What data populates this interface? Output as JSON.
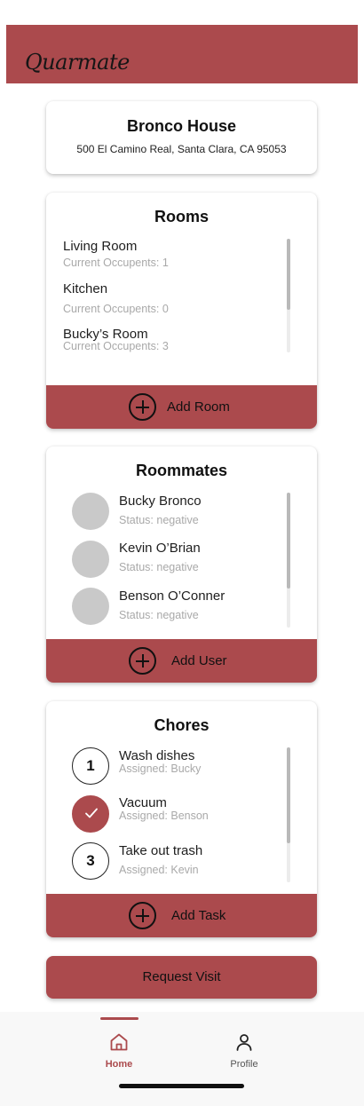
{
  "app": {
    "title": "Quarmate"
  },
  "colors": {
    "accent": "#ab4a4d",
    "avatar_placeholder": "#c9c9c9",
    "muted_text": "#a9a9a9"
  },
  "house": {
    "name": "Bronco House",
    "address": "500 El Camino Real, Santa Clara, CA 95053"
  },
  "rooms": {
    "title": "Rooms",
    "items": [
      {
        "name": "Living Room",
        "occupants": "Current Occupents: 1"
      },
      {
        "name": "Kitchen",
        "occupants": "Current Occupents: 0"
      },
      {
        "name": "Bucky’s Room",
        "occupants": "Current Occupents: 3"
      }
    ],
    "add_label": "Add Room"
  },
  "roommates": {
    "title": "Roommates",
    "items": [
      {
        "name": "Bucky Bronco",
        "status": "Status: negative"
      },
      {
        "name": "Kevin O’Brian",
        "status": "Status: negative"
      },
      {
        "name": "Benson O’Conner",
        "status": "Status: negative"
      }
    ],
    "add_label": "Add User"
  },
  "chores": {
    "title": "Chores",
    "items": [
      {
        "badge": "1",
        "done": false,
        "task": "Wash dishes",
        "assigned": "Assigned: Bucky"
      },
      {
        "badge": "",
        "done": true,
        "task": "Vacuum",
        "assigned": "Assigned: Benson"
      },
      {
        "badge": "3",
        "done": false,
        "task": "Take out trash",
        "assigned": "Assigned: Kevin"
      }
    ],
    "add_label": "Add Task"
  },
  "request_button": {
    "label": "Request Visit"
  },
  "tabs": [
    {
      "label": "Home",
      "icon": "home-icon",
      "active": true
    },
    {
      "label": "Profile",
      "icon": "person-icon",
      "active": false
    }
  ]
}
